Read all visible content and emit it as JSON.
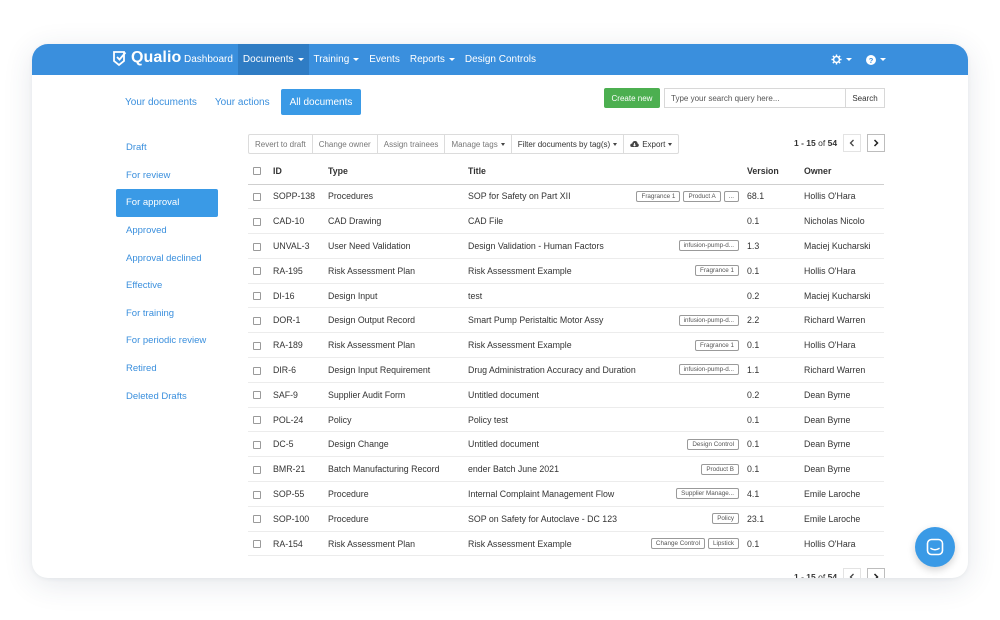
{
  "app": {
    "brand": "Qualio",
    "nav": [
      {
        "label": "Dashboard",
        "dropdown": false
      },
      {
        "label": "Documents",
        "dropdown": true,
        "active": true
      },
      {
        "label": "Training",
        "dropdown": true
      },
      {
        "label": "Events",
        "dropdown": false
      },
      {
        "label": "Reports",
        "dropdown": true
      },
      {
        "label": "Design Controls",
        "dropdown": false
      }
    ],
    "nav_right_icons": [
      "settings-icon",
      "help-icon"
    ],
    "accent": "#3a8fdd"
  },
  "tabs": [
    "Your documents",
    "Your actions",
    "All documents"
  ],
  "active_tab": "All documents",
  "actions": {
    "create_label": "Create new",
    "search_placeholder": "Type your search query here...",
    "search_label": "Search",
    "create_color": "#4caf50"
  },
  "sidebar": {
    "items": [
      "Draft",
      "For review",
      "For approval",
      "Approved",
      "Approval declined",
      "Effective",
      "For training",
      "For periodic review",
      "Retired",
      "Deleted Drafts"
    ],
    "active": "For approval"
  },
  "toolbar": {
    "buttons": [
      "Revert to draft",
      "Change owner",
      "Assign trainees"
    ],
    "manage_tags": "Manage tags",
    "filter_tags": "Filter documents by tag(s)",
    "export": "Export"
  },
  "pagination": {
    "range": "1 - 15",
    "of": "of",
    "total": "54"
  },
  "table": {
    "headers": [
      "ID",
      "Type",
      "Title",
      "Version",
      "Owner"
    ],
    "rows": [
      {
        "id": "SOPP-138",
        "type": "Procedures",
        "title": "SOP for Safety on Part XII",
        "tags": [
          "Fragrance 1",
          "Product A",
          "..."
        ],
        "version": "68.1",
        "owner": "Hollis O'Hara"
      },
      {
        "id": "CAD-10",
        "type": "CAD Drawing",
        "title": "CAD File",
        "tags": [],
        "version": "0.1",
        "owner": "Nicholas Nicolo"
      },
      {
        "id": "UNVAL-3",
        "type": "User Need Validation",
        "title": "Design Validation - Human Factors",
        "tags": [
          "infusion-pump-d..."
        ],
        "version": "1.3",
        "owner": "Maciej Kucharski"
      },
      {
        "id": "RA-195",
        "type": "Risk Assessment Plan",
        "title": "Risk Assessment Example",
        "tags": [
          "Fragrance 1"
        ],
        "version": "0.1",
        "owner": "Hollis O'Hara"
      },
      {
        "id": "DI-16",
        "type": "Design Input",
        "title": "test",
        "tags": [],
        "version": "0.2",
        "owner": "Maciej Kucharski"
      },
      {
        "id": "DOR-1",
        "type": "Design Output Record",
        "title": "Smart Pump Peristaltic Motor Assy",
        "tags": [
          "infusion-pump-d..."
        ],
        "version": "2.2",
        "owner": "Richard Warren"
      },
      {
        "id": "RA-189",
        "type": "Risk Assessment Plan",
        "title": "Risk Assessment Example",
        "tags": [
          "Fragrance 1"
        ],
        "version": "0.1",
        "owner": "Hollis O'Hara"
      },
      {
        "id": "DIR-6",
        "type": "Design Input Requirement",
        "title": "Drug Administration Accuracy and Duration",
        "tags": [
          "infusion-pump-d..."
        ],
        "version": "1.1",
        "owner": "Richard Warren"
      },
      {
        "id": "SAF-9",
        "type": "Supplier Audit Form",
        "title": "Untitled document",
        "tags": [],
        "version": "0.2",
        "owner": "Dean Byrne"
      },
      {
        "id": "POL-24",
        "type": "Policy",
        "title": "Policy test",
        "tags": [],
        "version": "0.1",
        "owner": "Dean Byrne"
      },
      {
        "id": "DC-5",
        "type": "Design Change",
        "title": "Untitled document",
        "tags": [
          "Design Control"
        ],
        "version": "0.1",
        "owner": "Dean Byrne"
      },
      {
        "id": "BMR-21",
        "type": "Batch Manufacturing Record",
        "title": "ender Batch June 2021",
        "tags": [
          "Product B"
        ],
        "version": "0.1",
        "owner": "Dean Byrne"
      },
      {
        "id": "SOP-55",
        "type": "Procedure",
        "title": "Internal Complaint Management Flow",
        "tags": [
          "Supplier Manage..."
        ],
        "version": "4.1",
        "owner": "Emile Laroche"
      },
      {
        "id": "SOP-100",
        "type": "Procedure",
        "title": "SOP on Safety for Autoclave - DC 123",
        "tags": [
          "Policy"
        ],
        "version": "23.1",
        "owner": "Emile Laroche"
      },
      {
        "id": "RA-154",
        "type": "Risk Assessment Plan",
        "title": "Risk Assessment Example",
        "tags": [
          "Change Control",
          "Lipstick"
        ],
        "version": "0.1",
        "owner": "Hollis O'Hara"
      }
    ]
  }
}
